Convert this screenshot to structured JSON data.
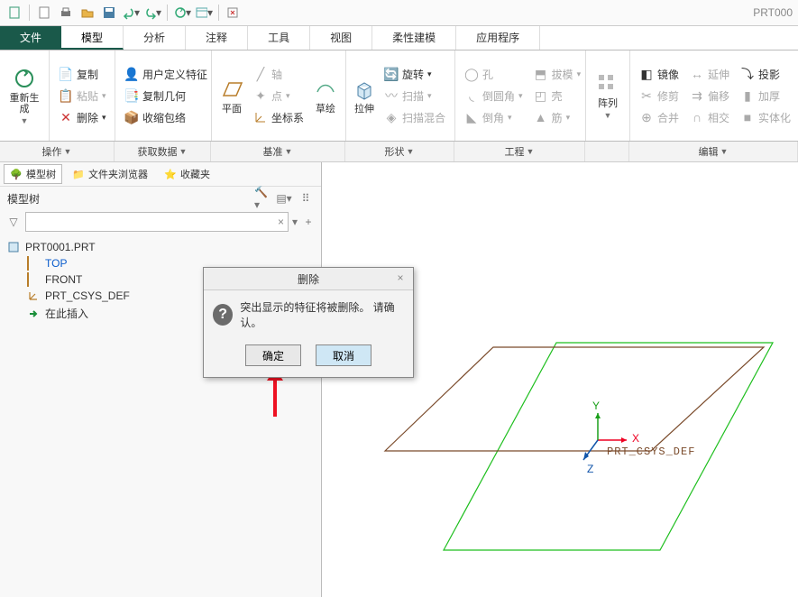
{
  "qat_title": "PRT000",
  "tabs": [
    "文件",
    "模型",
    "分析",
    "注释",
    "工具",
    "视图",
    "柔性建模",
    "应用程序"
  ],
  "ribbon": {
    "g0": {
      "label": "",
      "regen": "重新生成"
    },
    "g1": {
      "label": "操作",
      "copy": "复制",
      "paste": "粘贴",
      "del": "删除"
    },
    "g2": {
      "label": "获取数据",
      "udf": "用户定义特征",
      "copygeom": "复制几何",
      "shrink": "收缩包络"
    },
    "g3": {
      "label": "基准",
      "plane": "平面",
      "axis": "轴",
      "point": "点",
      "csys": "坐标系",
      "sketch": "草绘"
    },
    "g4": {
      "label": "形状",
      "extrude": "拉伸",
      "rev": "旋转",
      "sweep": "扫描",
      "blend": "扫描混合"
    },
    "g5": {
      "label": "工程",
      "hole": "孔",
      "round": "倒圆角",
      "chamfer": "倒角",
      "draft": "拔模",
      "shell": "壳",
      "rib": "筋"
    },
    "g6": {
      "label": "阵列",
      "pattern": "阵列"
    },
    "g7": {
      "label": "编辑",
      "mirror": "镜像",
      "trim": "修剪",
      "merge": "合并",
      "extend": "延伸",
      "offset": "偏移",
      "intersect": "相交",
      "proj": "投影",
      "thick": "加厚",
      "solid": "实体化"
    }
  },
  "sidetabs": {
    "tree": "模型树",
    "folder": "文件夹浏览器",
    "fav": "收藏夹"
  },
  "treelabel": "模型树",
  "treeitems": {
    "root": "PRT0001.PRT",
    "top": "TOP",
    "front": "FRONT",
    "csys": "PRT_CSYS_DEF",
    "insert": "在此插入"
  },
  "dialog": {
    "title": "删除",
    "msg": "突出显示的特征将被删除。 请确认。",
    "ok": "确定",
    "cancel": "取消"
  },
  "canvas": {
    "csys_label": "PRT_CSYS_DEF",
    "x": "X",
    "y": "Y",
    "z": "Z"
  }
}
